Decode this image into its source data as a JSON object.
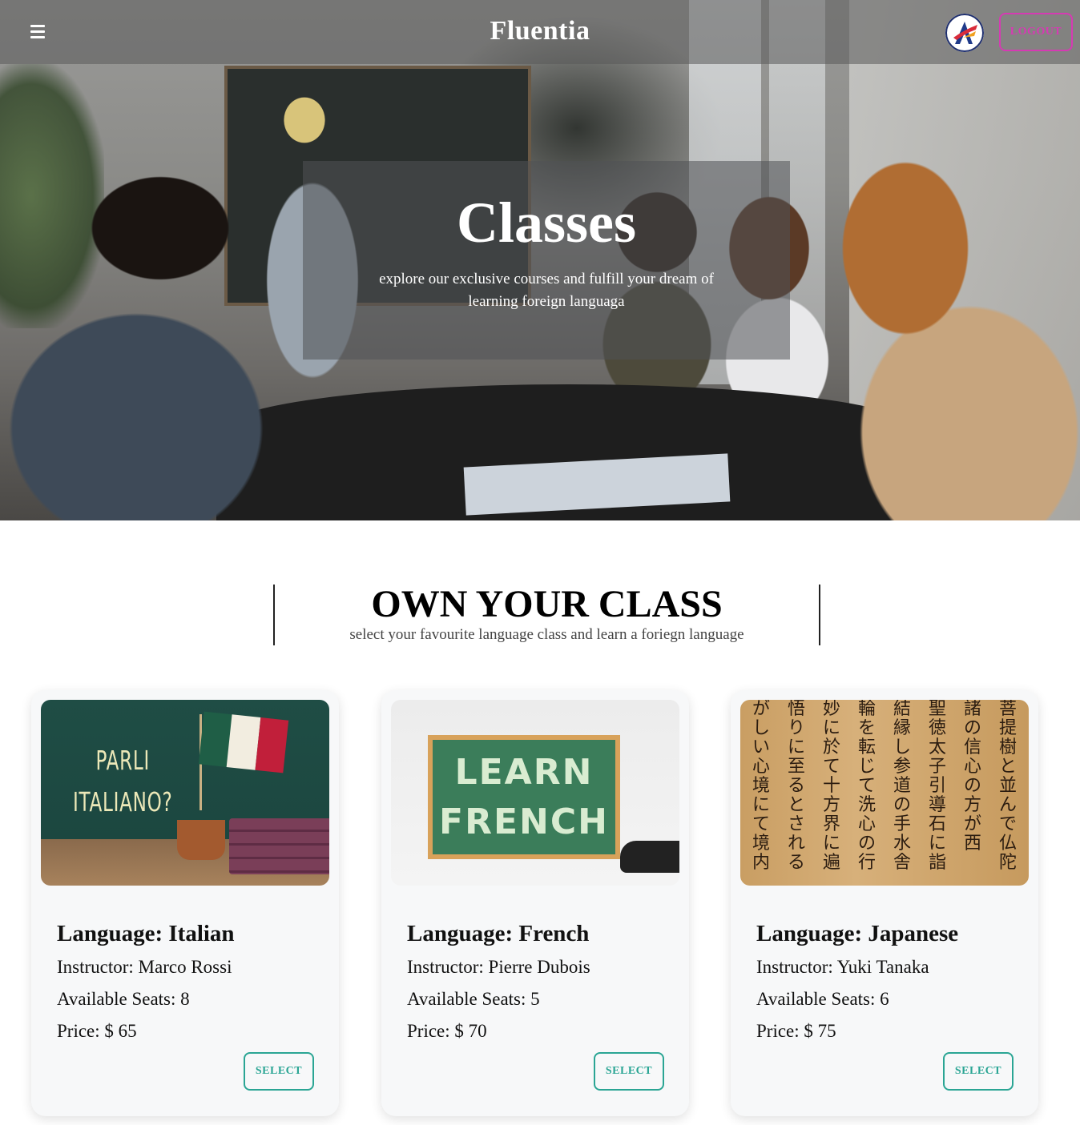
{
  "nav": {
    "brand": "Fluentia",
    "logout_label": "LOGOUT"
  },
  "hero": {
    "title": "Classes",
    "subtitle": "explore our exclusive courses and fulfill your dream of learning foreign languaga"
  },
  "section": {
    "title": "OWN YOUR CLASS",
    "subtitle": "select your favourite language class and learn a foriegn language"
  },
  "cards": [
    {
      "language": "Language: Italian",
      "instructor": "Instructor: Marco Rossi",
      "seats": "Available Seats: 8",
      "price": "Price: $ 65",
      "select_label": "SELECT",
      "image_text_1": "PARLI",
      "image_text_2": "ITALIANO?"
    },
    {
      "language": "Language: French",
      "instructor": "Instructor: Pierre Dubois",
      "seats": "Available Seats: 5",
      "price": "Price: $ 70",
      "select_label": "SELECT",
      "image_text_1": "LEARN",
      "image_text_2": "FRENCH"
    },
    {
      "language": "Language: Japanese",
      "instructor": "Instructor: Yuki Tanaka",
      "seats": "Available Seats: 6",
      "price": "Price: $ 75",
      "select_label": "SELECT"
    }
  ],
  "icons": {
    "menu": "hamburger-menu-icon",
    "avatar": "user-avatar-logo"
  },
  "colors": {
    "logout_accent": "#d63ab3",
    "select_accent": "#2aa594",
    "card_bg": "#f7f8f9",
    "flag_green": "#1f5e46",
    "flag_white": "#f2ede0",
    "flag_red": "#c11f3a"
  }
}
